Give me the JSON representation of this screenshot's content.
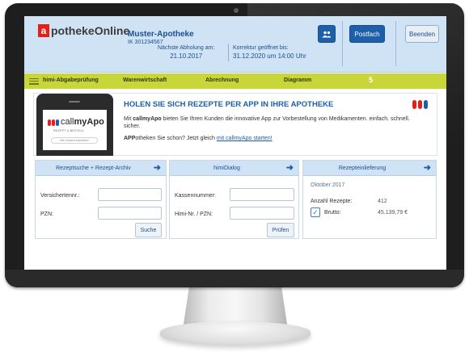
{
  "header": {
    "logo_letter": "a",
    "logo_text": "potheke",
    "logo_text_suffix": "Online",
    "pharmacy_name": "Muster-Apotheke",
    "pharmacy_ik": "IK 301234567",
    "pickup_label": "Nächste Abholung am:",
    "pickup_date": "21.10.2017",
    "correction_label": "Korrektur geöffnet bis:",
    "correction_date": "31.12.2020 um 14:00 Uhr",
    "users_icon": "users-icon",
    "postfach_label": "Postfach",
    "beenden_label": "Beenden"
  },
  "nav": {
    "items": [
      "himi-Abgabeprüfung",
      "Warenwirtschaft",
      "Abrechnung",
      "Diagramm"
    ],
    "more": "5"
  },
  "promo": {
    "title": "HOLEN SIE SICH REZEPTE PER APP IN IHRE APOTHEKE",
    "text_prefix": "Mit ",
    "text_brand": "callmyApo",
    "text_rest": " bieten Sie Ihren Kunden die innovative App zur Vorbestellung von Medikamenten. einfach. schnell. sicher.",
    "line2_bold": "APP",
    "line2_text": "otheken Sie schon? Jetzt gleich ",
    "line2_link": "mit callmyApo starten!",
    "app_brand_a": "call",
    "app_brand_b": "myApo",
    "app_sub": "REZEPT & BESTELL",
    "app_button": "Hier einfach anmelden!",
    "brand_colors": [
      "#e32119",
      "#e32119",
      "#1d5fa8"
    ]
  },
  "panels": {
    "p1": {
      "title": "Rezeptsuche + Rezept-Archiv",
      "label1": "Versichertennr.:",
      "label2": "PZN:",
      "button": "Suche"
    },
    "p2": {
      "title": "himiDialog",
      "label1": "Kassennummer:",
      "label2": "Himi-Nr. / PZN:",
      "button": "Prüfen"
    },
    "p3": {
      "title": "Rezepteinlieferung",
      "month": "Oktober 2017",
      "count_label": "Anzahl Rezepte:",
      "count_value": "412",
      "gross_label": "Brutto:",
      "gross_value": "45.139,79 €"
    }
  },
  "colors": {
    "header_bg": "#cfe3f4",
    "nav_bg": "#c9d63a",
    "accent_blue": "#1d5fa8",
    "logo_red": "#e32119"
  }
}
